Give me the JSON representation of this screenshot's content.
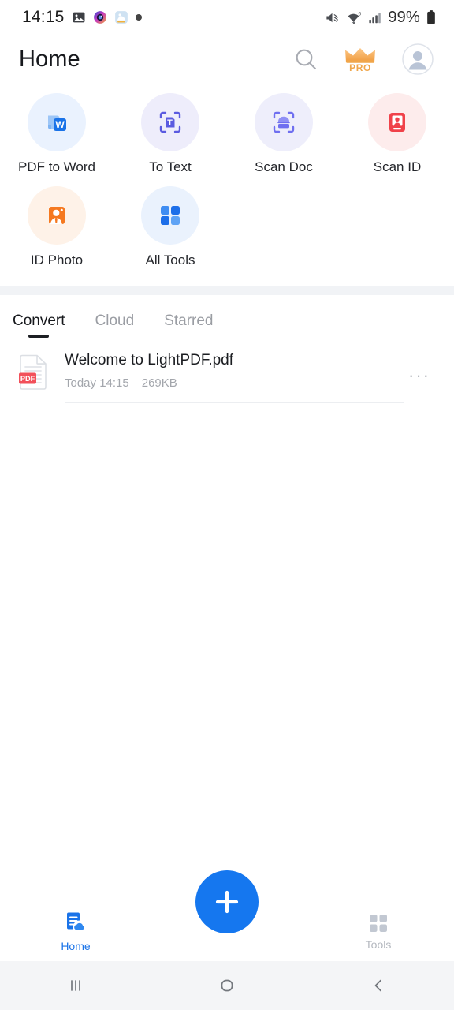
{
  "statusbar": {
    "time": "14:15",
    "battery_percent": "99%",
    "icons": [
      "gallery-icon",
      "camera-app-icon",
      "photo-app-icon",
      "notification-dot"
    ],
    "right_icons": [
      "mute-icon",
      "wifi-icon",
      "signal-icon",
      "battery-icon"
    ]
  },
  "header": {
    "title": "Home",
    "search_icon": "search-icon",
    "pro_label": "PRO",
    "pro_icon": "crown-icon",
    "avatar_icon": "avatar-icon"
  },
  "tools": [
    {
      "label": "PDF to Word",
      "icon": "pdf-to-word-icon",
      "bg": "#eaf2fe",
      "accent": "#1a73e8"
    },
    {
      "label": "To Text",
      "icon": "to-text-icon",
      "bg": "#eeedfb",
      "accent": "#5a5ae0"
    },
    {
      "label": "Scan Doc",
      "icon": "scan-doc-icon",
      "bg": "#eeeefb",
      "accent": "#6f6ff0"
    },
    {
      "label": "Scan ID",
      "icon": "scan-id-icon",
      "bg": "#fdecec",
      "accent": "#f0424a"
    },
    {
      "label": "ID Photo",
      "icon": "id-photo-icon",
      "bg": "#fef2e8",
      "accent": "#f57920"
    },
    {
      "label": "All Tools",
      "icon": "all-tools-icon",
      "bg": "#eaf2fd",
      "accent": "#1d74ee"
    }
  ],
  "tabs": [
    {
      "label": "Convert",
      "active": true
    },
    {
      "label": "Cloud",
      "active": false
    },
    {
      "label": "Starred",
      "active": false
    }
  ],
  "files": [
    {
      "name": "Welcome to LightPDF.pdf",
      "date": "Today 14:15",
      "size": "269KB",
      "type_badge": "PDF",
      "more_label": "···"
    }
  ],
  "bottom_nav": {
    "home_label": "Home",
    "home_icon": "home-doc-cloud-icon",
    "tools_label": "Tools",
    "tools_icon": "tools-grid-icon",
    "fab_icon": "plus-icon"
  },
  "android_nav": {
    "recents": "recents-icon",
    "home": "home-circle-icon",
    "back": "back-chevron-icon"
  },
  "colors": {
    "accent_blue": "#1577ef",
    "pro_orange": "#f0a64a",
    "pdf_red": "#f0424a",
    "divider": "#f1f3f6"
  }
}
